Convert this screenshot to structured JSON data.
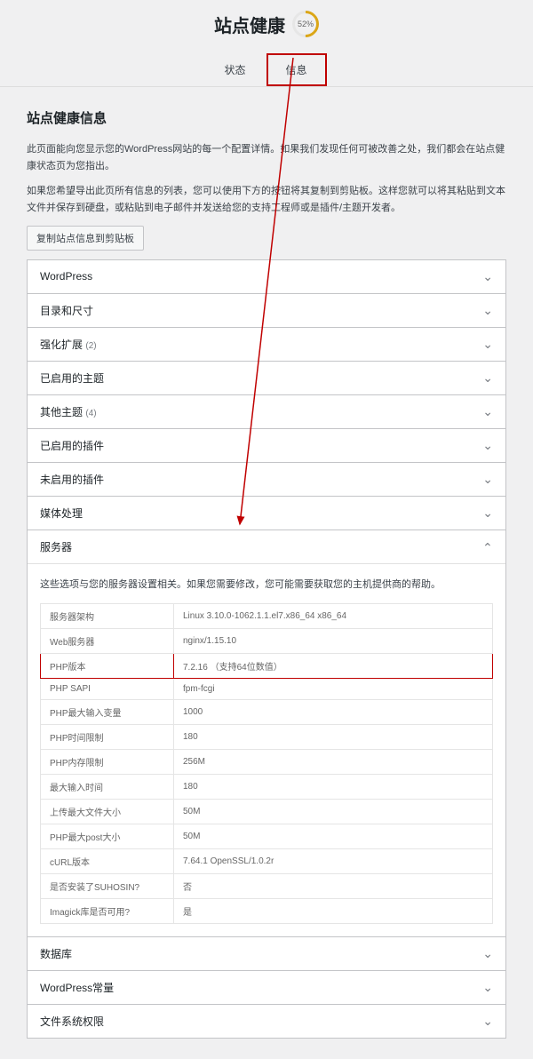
{
  "header": {
    "title": "站点健康",
    "score": "52%"
  },
  "tabs": {
    "status": "状态",
    "info": "信息"
  },
  "content": {
    "heading": "站点健康信息",
    "desc1": "此页面能向您显示您的WordPress网站的每一个配置详情。如果我们发现任何可被改善之处，我们都会在站点健康状态页为您指出。",
    "desc2": "如果您希望导出此页所有信息的列表，您可以使用下方的按钮将其复制到剪贴板。这样您就可以将其粘贴到文本文件并保存到硬盘，或粘贴到电子邮件并发送给您的支持工程师或是插件/主题开发者。",
    "copy_btn": "复制站点信息到剪贴板"
  },
  "accordions": {
    "wordpress": "WordPress",
    "dirs": "目录和尺寸",
    "ext": "强化扩展",
    "ext_count": "(2)",
    "active_theme": "已启用的主题",
    "other_themes": "其他主题",
    "other_themes_count": "(4)",
    "active_plugins": "已启用的插件",
    "inactive_plugins": "未启用的插件",
    "media": "媒体处理",
    "server": "服务器",
    "database": "数据库",
    "wp_constants": "WordPress常量",
    "filesystem": "文件系统权限"
  },
  "server": {
    "note": "这些选项与您的服务器设置相关。如果您需要修改，您可能需要获取您的主机提供商的帮助。",
    "rows": [
      {
        "label": "服务器架构",
        "value": "Linux 3.10.0-1062.1.1.el7.x86_64 x86_64"
      },
      {
        "label": "Web服务器",
        "value": "nginx/1.15.10"
      },
      {
        "label": "PHP版本",
        "value": "7.2.16 （支持64位数值）"
      },
      {
        "label": "PHP SAPI",
        "value": "fpm-fcgi"
      },
      {
        "label": "PHP最大输入变量",
        "value": "1000"
      },
      {
        "label": "PHP时间限制",
        "value": "180"
      },
      {
        "label": "PHP内存限制",
        "value": "256M"
      },
      {
        "label": "最大输入时间",
        "value": "180"
      },
      {
        "label": "上传最大文件大小",
        "value": "50M"
      },
      {
        "label": "PHP最大post大小",
        "value": "50M"
      },
      {
        "label": "cURL版本",
        "value": "7.64.1 OpenSSL/1.0.2r"
      },
      {
        "label": "是否安装了SUHOSIN?",
        "value": "否"
      },
      {
        "label": "Imagick库是否可用?",
        "value": "是"
      }
    ]
  }
}
